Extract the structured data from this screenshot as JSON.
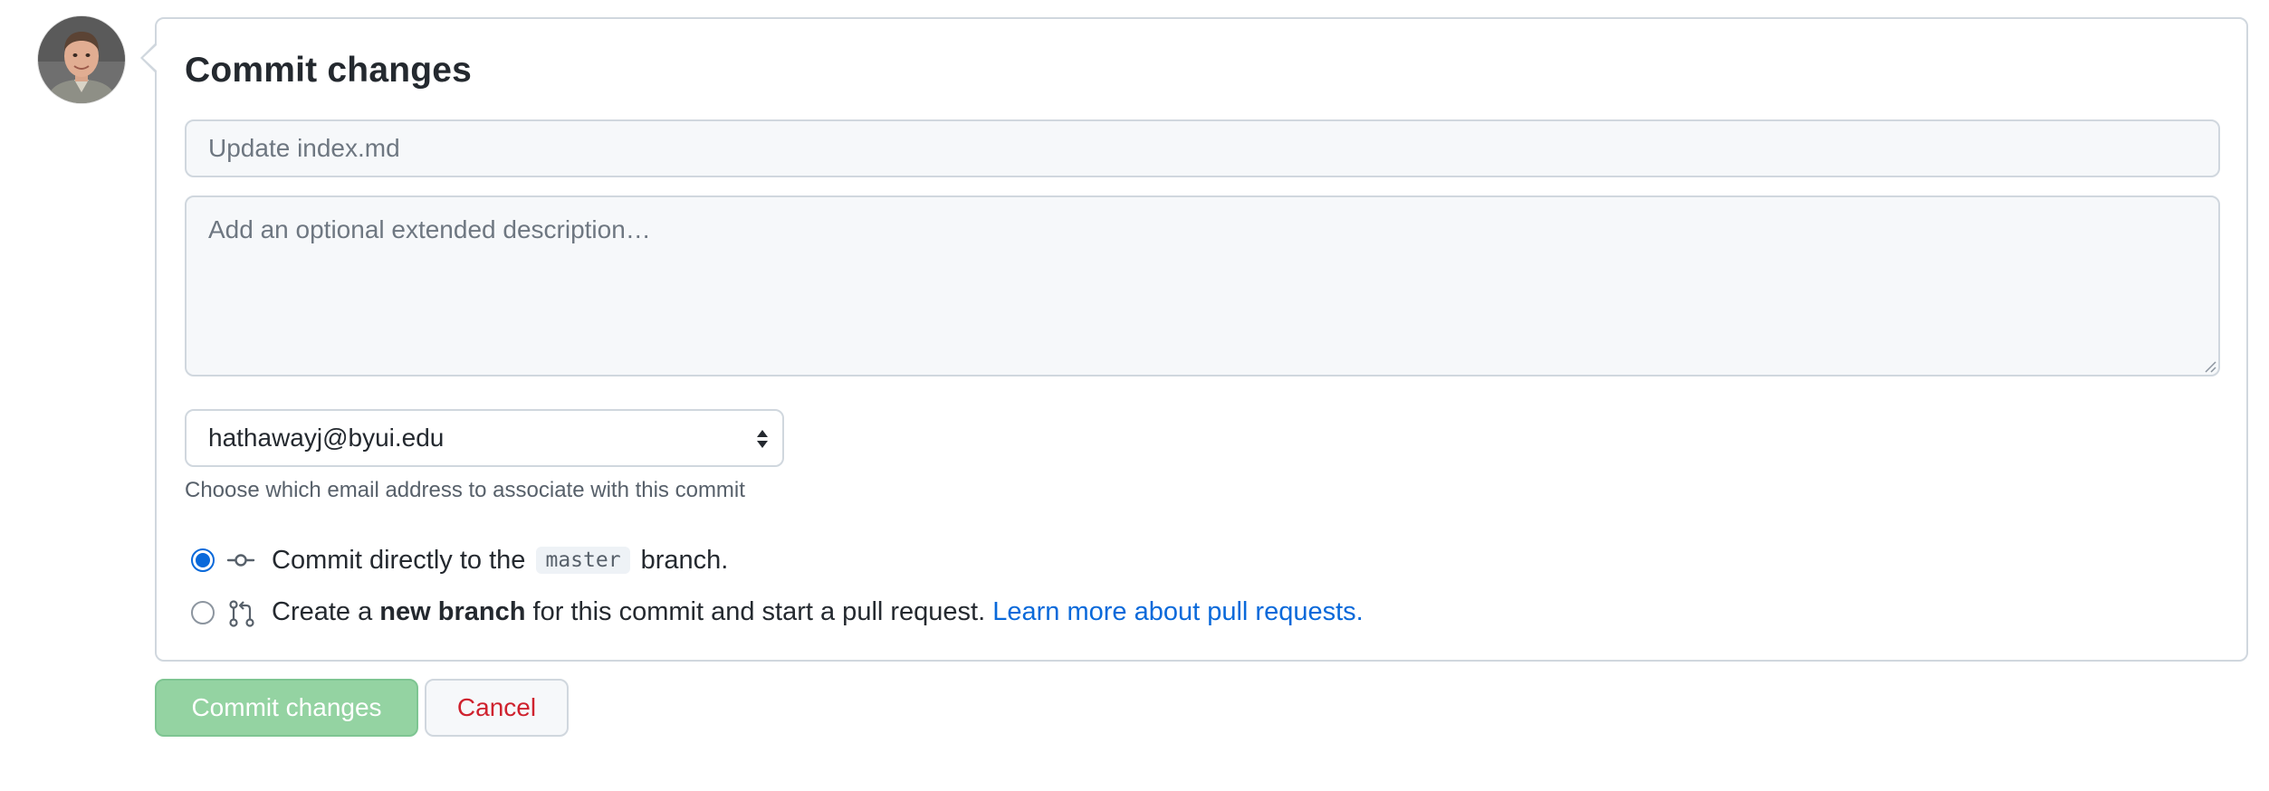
{
  "user": {
    "avatar_icon": "user-avatar-photo"
  },
  "form": {
    "title": "Commit changes",
    "summary_placeholder": "Update index.md",
    "summary_value": "",
    "description_placeholder": "Add an optional extended description…",
    "description_value": ""
  },
  "email_select": {
    "selected": "hathawayj@byui.edu",
    "icon": "select-arrows-icon",
    "help_text": "Choose which email address to associate with this commit"
  },
  "options": {
    "direct": {
      "selected": true,
      "icon": "git-commit-icon",
      "text_before": "Commit directly to the",
      "branch_name": "master",
      "text_after": "branch."
    },
    "new_branch": {
      "selected": false,
      "icon": "git-pull-request-icon",
      "text_before": "Create a",
      "bold_text": "new branch",
      "text_after": "for this commit and start a pull request.",
      "link_text": "Learn more about pull requests."
    }
  },
  "actions": {
    "commit_label": "Commit changes",
    "cancel_label": "Cancel"
  },
  "colors": {
    "accent": "#0969da",
    "commit_button_disabled": "#94d3a2",
    "cancel_text": "#cf222e",
    "border": "#d0d7de"
  }
}
